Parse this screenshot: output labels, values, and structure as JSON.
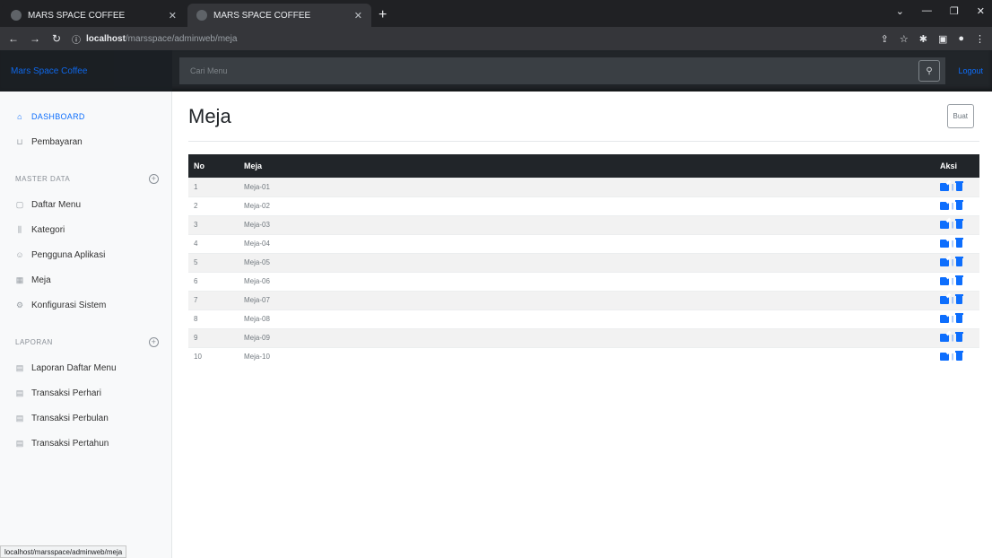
{
  "browser": {
    "tabs": [
      {
        "title": "MARS SPACE COFFEE",
        "active": false
      },
      {
        "title": "MARS SPACE COFFEE",
        "active": true
      }
    ],
    "url_host": "localhost",
    "url_path": "/marsspace/adminweb/meja",
    "status_url": "localhost/marsspace/adminweb/meja"
  },
  "app": {
    "brand": "Mars Space Coffee",
    "search_placeholder": "Cari Menu",
    "logout": "Logout"
  },
  "sidebar": {
    "dashboard": "DASHBOARD",
    "pembayaran": "Pembayaran",
    "master_heading": "MASTER DATA",
    "master_items": [
      {
        "label": "Daftar Menu",
        "icon": "file-icon"
      },
      {
        "label": "Kategori",
        "icon": "bar-chart-icon"
      },
      {
        "label": "Pengguna Aplikasi",
        "icon": "users-icon"
      },
      {
        "label": "Meja",
        "icon": "table-icon"
      },
      {
        "label": "Konfigurasi Sistem",
        "icon": "settings-icon"
      }
    ],
    "laporan_heading": "LAPORAN",
    "laporan_items": [
      {
        "label": "Laporan Daftar Menu",
        "icon": "document-icon"
      },
      {
        "label": "Transaksi Perhari",
        "icon": "document-icon"
      },
      {
        "label": "Transaksi Perbulan",
        "icon": "document-icon"
      },
      {
        "label": "Transaksi Pertahun",
        "icon": "document-icon"
      }
    ]
  },
  "page": {
    "title": "Meja",
    "create_button": "Buat",
    "columns": [
      "No",
      "Meja",
      "Aksi"
    ],
    "rows": [
      {
        "no": "1",
        "meja": "Meja-01"
      },
      {
        "no": "2",
        "meja": "Meja-02"
      },
      {
        "no": "3",
        "meja": "Meja-03"
      },
      {
        "no": "4",
        "meja": "Meja-04"
      },
      {
        "no": "5",
        "meja": "Meja-05"
      },
      {
        "no": "6",
        "meja": "Meja-06"
      },
      {
        "no": "7",
        "meja": "Meja-07"
      },
      {
        "no": "8",
        "meja": "Meja-08"
      },
      {
        "no": "9",
        "meja": "Meja-09"
      },
      {
        "no": "10",
        "meja": "Meja-10"
      }
    ],
    "row_action_separator": "|"
  },
  "colors": {
    "accent": "#0d6efd",
    "navbar": "#212529",
    "sidebar": "#f8f9fa"
  }
}
